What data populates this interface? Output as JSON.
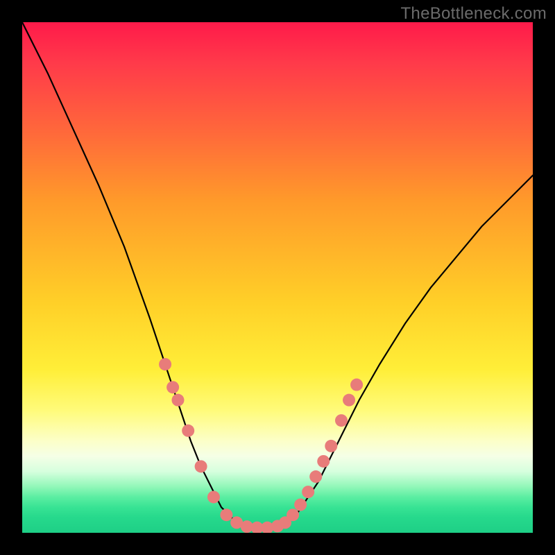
{
  "watermark": "TheBottleneck.com",
  "chart_data": {
    "type": "line",
    "title": "",
    "xlabel": "",
    "ylabel": "",
    "xlim": [
      0,
      100
    ],
    "ylim": [
      0,
      100
    ],
    "grid": false,
    "legend": false,
    "series": [
      {
        "name": "curve",
        "x": [
          0,
          5,
          10,
          15,
          20,
          25,
          27,
          29,
          31,
          33,
          35,
          37,
          39,
          40,
          42,
          44,
          46,
          48,
          50,
          52,
          54,
          56,
          58,
          60,
          63,
          66,
          70,
          75,
          80,
          85,
          90,
          95,
          100
        ],
        "y": [
          100,
          90,
          79,
          68,
          56,
          42,
          36,
          30,
          24,
          18,
          13,
          9,
          5,
          4,
          2,
          1,
          1,
          1,
          1,
          2,
          4,
          7,
          10,
          14,
          20,
          26,
          33,
          41,
          48,
          54,
          60,
          65,
          70
        ]
      }
    ],
    "markers": [
      {
        "x": 28.0,
        "y": 33.0
      },
      {
        "x": 29.5,
        "y": 28.5
      },
      {
        "x": 30.5,
        "y": 26.0
      },
      {
        "x": 32.5,
        "y": 20.0
      },
      {
        "x": 35.0,
        "y": 13.0
      },
      {
        "x": 37.5,
        "y": 7.0
      },
      {
        "x": 40.0,
        "y": 3.5
      },
      {
        "x": 42.0,
        "y": 2.0
      },
      {
        "x": 44.0,
        "y": 1.2
      },
      {
        "x": 46.0,
        "y": 1.0
      },
      {
        "x": 48.0,
        "y": 1.0
      },
      {
        "x": 50.0,
        "y": 1.3
      },
      {
        "x": 51.5,
        "y": 2.0
      },
      {
        "x": 53.0,
        "y": 3.5
      },
      {
        "x": 54.5,
        "y": 5.5
      },
      {
        "x": 56.0,
        "y": 8.0
      },
      {
        "x": 57.5,
        "y": 11.0
      },
      {
        "x": 59.0,
        "y": 14.0
      },
      {
        "x": 60.5,
        "y": 17.0
      },
      {
        "x": 62.5,
        "y": 22.0
      },
      {
        "x": 64.0,
        "y": 26.0
      },
      {
        "x": 65.5,
        "y": 29.0
      }
    ],
    "background_gradient": {
      "top": "#ff1a4a",
      "middle": "#ffee38",
      "bottom": "#1ecf86"
    }
  }
}
